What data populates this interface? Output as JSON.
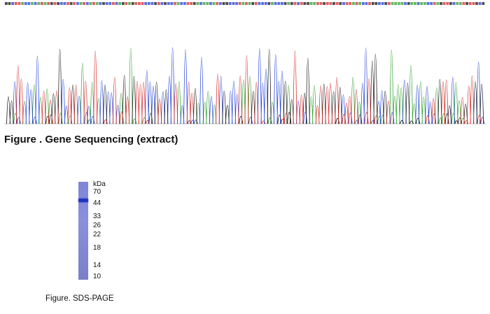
{
  "sequencing": {
    "caption": "Figure . Gene Sequencing (extract)",
    "trace_colors": {
      "A": "#2ca02c",
      "C": "#1f3fd6",
      "G": "#111111",
      "T": "#d62728"
    }
  },
  "sds_page": {
    "caption": "Figure. SDS-PAGE",
    "unit_label": "kDa",
    "markers": [
      "70",
      "44",
      "33",
      "26",
      "22",
      "18",
      "14",
      "10"
    ],
    "band_kda": 55,
    "lane_color": "#7f86d8",
    "band_color": "#1f35c0"
  }
}
